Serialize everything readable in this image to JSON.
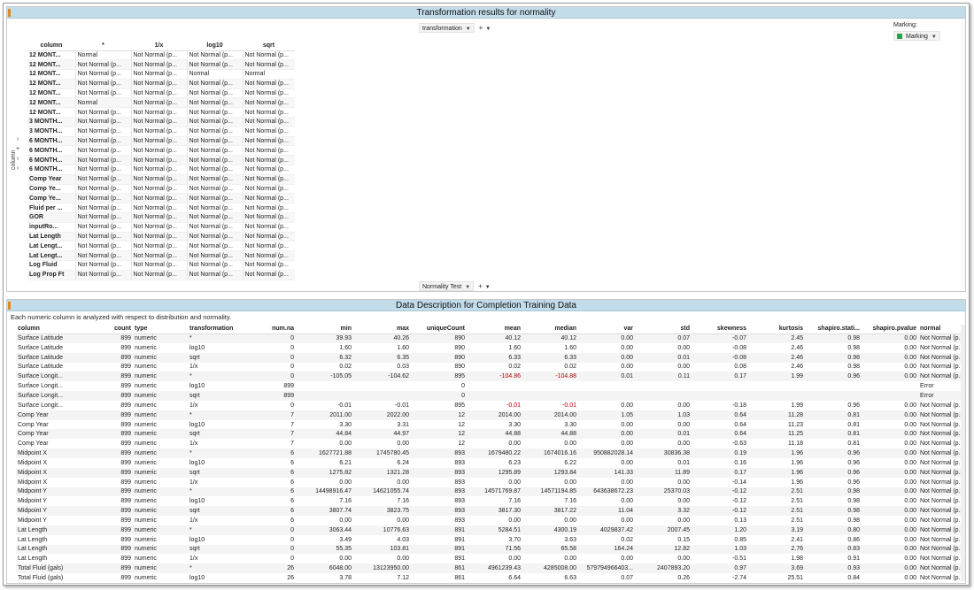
{
  "top_panel": {
    "title": "Transformation results for normality",
    "column_axis": {
      "label": "transformation",
      "plus": "+"
    },
    "row_axis_bottom": {
      "label": "Normality Test",
      "plus": "+"
    },
    "marking": {
      "label": "Marking:",
      "value": "Marking",
      "color": "#1aa84a"
    },
    "side_label": "column",
    "side_controls": [
      "›",
      "+",
      "›",
      "›"
    ],
    "headers": [
      "column",
      "*",
      "1/x",
      "log10",
      "sqrt"
    ],
    "rows": [
      [
        "12 MONT...",
        "Normal",
        "Not Normal (p...",
        "Not Normal (p...",
        "Not Normal (p..."
      ],
      [
        "12 MONT...",
        "Not Normal (p...",
        "Not Normal (p...",
        "Not Normal (p...",
        "Not Normal (p..."
      ],
      [
        "12 MONT...",
        "Not Normal (p...",
        "Not Normal (p...",
        "Normal",
        "Normal"
      ],
      [
        "12 MONT...",
        "Not Normal (p...",
        "Not Normal (p...",
        "Not Normal (p...",
        "Not Normal (p..."
      ],
      [
        "12 MONT...",
        "Not Normal (p...",
        "Not Normal (p...",
        "Not Normal (p...",
        "Not Normal (p..."
      ],
      [
        "12 MONT...",
        "Normal",
        "Not Normal (p...",
        "Not Normal (p...",
        "Not Normal (p..."
      ],
      [
        "12 MONT...",
        "Not Normal (p...",
        "Not Normal (p...",
        "Not Normal (p...",
        "Not Normal (p..."
      ],
      [
        "3 MONTH...",
        "Not Normal (p...",
        "Not Normal (p...",
        "Not Normal (p...",
        "Not Normal (p..."
      ],
      [
        "3 MONTH...",
        "Not Normal (p...",
        "Not Normal (p...",
        "Not Normal (p...",
        "Not Normal (p..."
      ],
      [
        "6 MONTH...",
        "Not Normal (p...",
        "Not Normal (p...",
        "Not Normal (p...",
        "Not Normal (p..."
      ],
      [
        "6 MONTH...",
        "Not Normal (p...",
        "Not Normal (p...",
        "Not Normal (p...",
        "Not Normal (p..."
      ],
      [
        "6 MONTH...",
        "Not Normal (p...",
        "Not Normal (p...",
        "Not Normal (p...",
        "Not Normal (p..."
      ],
      [
        "6 MONTH...",
        "Not Normal (p...",
        "Not Normal (p...",
        "Not Normal (p...",
        "Not Normal (p..."
      ],
      [
        "Comp Year",
        "Not Normal (p...",
        "Not Normal (p...",
        "Not Normal (p...",
        "Not Normal (p..."
      ],
      [
        "Comp Ye...",
        "Not Normal (p...",
        "Not Normal (p...",
        "Not Normal (p...",
        "Not Normal (p..."
      ],
      [
        "Comp Ye...",
        "Not Normal (p...",
        "Not Normal (p...",
        "Not Normal (p...",
        "Not Normal (p..."
      ],
      [
        "Fluid per ...",
        "Not Normal (p...",
        "Not Normal (p...",
        "Not Normal (p...",
        "Not Normal (p..."
      ],
      [
        "GOR",
        "Not Normal (p...",
        "Not Normal (p...",
        "Not Normal (p...",
        "Not Normal (p..."
      ],
      [
        "inputRo...",
        "Not Normal (p...",
        "Not Normal (p...",
        "Not Normal (p...",
        "Not Normal (p..."
      ],
      [
        "Lat Length",
        "Not Normal (p...",
        "Not Normal (p...",
        "Not Normal (p...",
        "Not Normal (p..."
      ],
      [
        "Lat Lengt...",
        "Not Normal (p...",
        "Not Normal (p...",
        "Not Normal (p...",
        "Not Normal (p..."
      ],
      [
        "Lat Lengt...",
        "Not Normal (p...",
        "Not Normal (p...",
        "Not Normal (p...",
        "Not Normal (p..."
      ],
      [
        "Log Fluid",
        "Not Normal (p...",
        "Not Normal (p...",
        "Not Normal (p...",
        "Not Normal (p..."
      ],
      [
        "Log Prop Ft",
        "Not Normal (p...",
        "Not Normal (p...",
        "Not Normal (p...",
        "Not Normal (p..."
      ]
    ]
  },
  "bottom_panel": {
    "title": "Data Description for Completion Training Data",
    "description": "Each numeric column is analyzed with respect to distribution and normality.",
    "headers": [
      "column",
      "count",
      "type",
      "transformation",
      "num.na",
      "min",
      "max",
      "uniqueCount",
      "mean",
      "median",
      "var",
      "std",
      "skewness",
      "kurtosis",
      "shapiro.stati...",
      "shapiro.pvalue",
      "normal"
    ],
    "rows": [
      [
        "Surface Latitude",
        "899",
        "numeric",
        "*",
        "0",
        "39.93",
        "40.26",
        "890",
        "40.12",
        "40.12",
        "0.00",
        "0.07",
        "-0.07",
        "2.45",
        "0.98",
        "0.00",
        "Not Normal (p..."
      ],
      [
        "Surface Latitude",
        "899",
        "numeric",
        "log10",
        "0",
        "1.60",
        "1.60",
        "890",
        "1.60",
        "1.60",
        "0.00",
        "0.00",
        "-0.08",
        "2.46",
        "0.98",
        "0.00",
        "Not Normal (p..."
      ],
      [
        "Surface Latitude",
        "899",
        "numeric",
        "sqrt",
        "0",
        "6.32",
        "6.35",
        "890",
        "6.33",
        "6.33",
        "0.00",
        "0.01",
        "-0.08",
        "2.46",
        "0.98",
        "0.00",
        "Not Normal (p..."
      ],
      [
        "Surface Latitude",
        "899",
        "numeric",
        "1/x",
        "0",
        "0.02",
        "0.03",
        "890",
        "0.02",
        "0.02",
        "0.00",
        "0.00",
        "0.08",
        "2.46",
        "0.98",
        "0.00",
        "Not Normal (p..."
      ],
      [
        "Surface Longit...",
        "899",
        "numeric",
        "*",
        "0",
        "-105.05",
        "-104.62",
        "895",
        "-104.86",
        "-104.88",
        "0.01",
        "0.11",
        "0.17",
        "1.99",
        "0.96",
        "0.00",
        "Not Normal (p..."
      ],
      [
        "Surface Longit...",
        "899",
        "numeric",
        "log10",
        "899",
        "",
        "",
        "0",
        "",
        "",
        "",
        "",
        "",
        "",
        "",
        "",
        "Error"
      ],
      [
        "Surface Longit...",
        "899",
        "numeric",
        "sqrt",
        "899",
        "",
        "",
        "0",
        "",
        "",
        "",
        "",
        "",
        "",
        "",
        "",
        "Error"
      ],
      [
        "Surface Longit...",
        "899",
        "numeric",
        "1/x",
        "0",
        "-0.01",
        "-0.01",
        "895",
        "-0.01",
        "-0.01",
        "0.00",
        "0.00",
        "-0.18",
        "1.99",
        "0.96",
        "0.00",
        "Not Normal (p..."
      ],
      [
        "Comp Year",
        "899",
        "numeric",
        "*",
        "7",
        "2011.00",
        "2022.00",
        "12",
        "2014.00",
        "2014.00",
        "1.05",
        "1.03",
        "0.64",
        "11.28",
        "0.81",
        "0.00",
        "Not Normal (p..."
      ],
      [
        "Comp Year",
        "899",
        "numeric",
        "log10",
        "7",
        "3.30",
        "3.31",
        "12",
        "3.30",
        "3.30",
        "0.00",
        "0.00",
        "0.64",
        "11.23",
        "0.81",
        "0.00",
        "Not Normal (p..."
      ],
      [
        "Comp Year",
        "899",
        "numeric",
        "sqrt",
        "7",
        "44.84",
        "44.97",
        "12",
        "44.88",
        "44.88",
        "0.00",
        "0.01",
        "0.64",
        "11.25",
        "0.81",
        "0.00",
        "Not Normal (p..."
      ],
      [
        "Comp Year",
        "899",
        "numeric",
        "1/x",
        "7",
        "0.00",
        "0.00",
        "12",
        "0.00",
        "0.00",
        "0.00",
        "0.00",
        "-0.63",
        "11.18",
        "0.81",
        "0.00",
        "Not Normal (p..."
      ],
      [
        "Midpoint X",
        "899",
        "numeric",
        "*",
        "6",
        "1627721.88",
        "1745780.45",
        "893",
        "1679480.22",
        "1674016.16",
        "950882028.14",
        "30836.38",
        "0.19",
        "1.96",
        "0.96",
        "0.00",
        "Not Normal (p..."
      ],
      [
        "Midpoint X",
        "899",
        "numeric",
        "log10",
        "6",
        "6.21",
        "6.24",
        "893",
        "6.23",
        "6.22",
        "0.00",
        "0.01",
        "0.16",
        "1.96",
        "0.96",
        "0.00",
        "Not Normal (p..."
      ],
      [
        "Midpoint X",
        "899",
        "numeric",
        "sqrt",
        "6",
        "1275.82",
        "1321.28",
        "893",
        "1295.89",
        "1293.84",
        "141.33",
        "11.89",
        "0.17",
        "1.96",
        "0.96",
        "0.00",
        "Not Normal (p..."
      ],
      [
        "Midpoint X",
        "899",
        "numeric",
        "1/x",
        "6",
        "0.00",
        "0.00",
        "893",
        "0.00",
        "0.00",
        "0.00",
        "0.00",
        "-0.14",
        "1.96",
        "0.96",
        "0.00",
        "Not Normal (p..."
      ],
      [
        "Midpoint Y",
        "899",
        "numeric",
        "*",
        "6",
        "14498916.47",
        "14621055.74",
        "893",
        "14571769.87",
        "14571194.85",
        "643638672.23",
        "25370.03",
        "-0.12",
        "2.51",
        "0.98",
        "0.00",
        "Not Normal (p..."
      ],
      [
        "Midpoint Y",
        "899",
        "numeric",
        "log10",
        "6",
        "7.16",
        "7.16",
        "893",
        "7.16",
        "7.16",
        "0.00",
        "0.00",
        "-0.12",
        "2.51",
        "0.98",
        "0.00",
        "Not Normal (p..."
      ],
      [
        "Midpoint Y",
        "899",
        "numeric",
        "sqrt",
        "6",
        "3807.74",
        "3823.75",
        "893",
        "3817.30",
        "3817.22",
        "11.04",
        "3.32",
        "-0.12",
        "2.51",
        "0.98",
        "0.00",
        "Not Normal (p..."
      ],
      [
        "Midpoint Y",
        "899",
        "numeric",
        "1/x",
        "6",
        "0.00",
        "0.00",
        "893",
        "0.00",
        "0.00",
        "0.00",
        "0.00",
        "0.13",
        "2.51",
        "0.98",
        "0.00",
        "Not Normal (p..."
      ],
      [
        "Lat Length",
        "899",
        "numeric",
        "*",
        "0",
        "3063.44",
        "10776.63",
        "891",
        "5284.51",
        "4300.19",
        "4029837.42",
        "2007.45",
        "1.20",
        "3.19",
        "0.80",
        "0.00",
        "Not Normal (p..."
      ],
      [
        "Lat Length",
        "899",
        "numeric",
        "log10",
        "0",
        "3.49",
        "4.03",
        "891",
        "3.70",
        "3.63",
        "0.02",
        "0.15",
        "0.85",
        "2.41",
        "0.86",
        "0.00",
        "Not Normal (p..."
      ],
      [
        "Lat Length",
        "899",
        "numeric",
        "sqrt",
        "0",
        "55.35",
        "103.81",
        "891",
        "71.56",
        "65.58",
        "164.24",
        "12.82",
        "1.03",
        "2.76",
        "0.83",
        "0.00",
        "Not Normal (p..."
      ],
      [
        "Lat Length",
        "899",
        "numeric",
        "1/x",
        "0",
        "0.00",
        "0.00",
        "891",
        "0.00",
        "0.00",
        "0.00",
        "0.00",
        "-0.51",
        "1.98",
        "0.91",
        "0.00",
        "Not Normal (p..."
      ],
      [
        "Total Fluid (gals)",
        "899",
        "numeric",
        "*",
        "26",
        "6048.00",
        "13123950.00",
        "861",
        "4961239.43",
        "4285008.00",
        "579794966403...",
        "2407893.20",
        "0.97",
        "3.69",
        "0.93",
        "0.00",
        "Not Normal (p..."
      ],
      [
        "Total Fluid (gals)",
        "899",
        "numeric",
        "log10",
        "26",
        "3.78",
        "7.12",
        "861",
        "6.64",
        "6.63",
        "0.07",
        "0.26",
        "-2.74",
        "25.51",
        "0.84",
        "0.00",
        "Not Normal (p..."
      ]
    ]
  }
}
